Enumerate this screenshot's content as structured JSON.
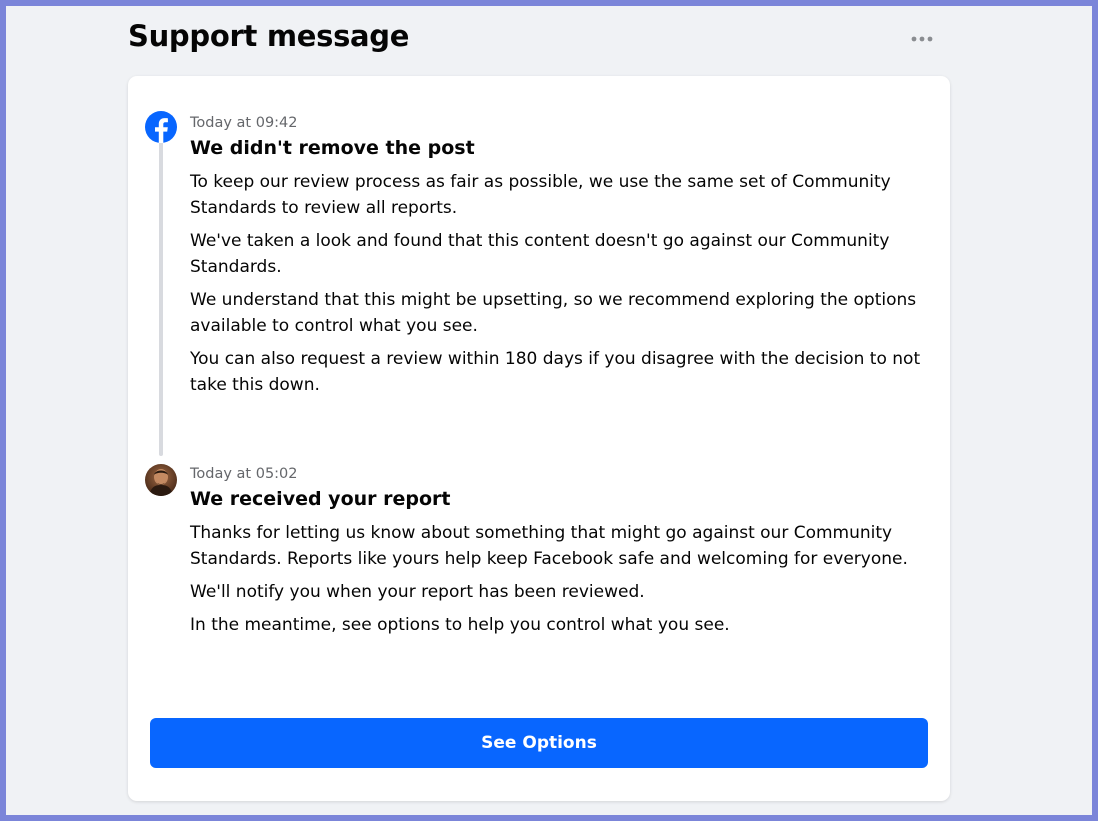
{
  "page": {
    "title": "Support message"
  },
  "header": {
    "more_icon": "more-horizontal-icon"
  },
  "messages": [
    {
      "sender_icon": "facebook-logo",
      "time": "Today at 09:42",
      "title": "We didn't remove the post",
      "paragraphs": [
        "To keep our review process as fair as possible, we use the same set of Community Standards to review all reports.",
        "We've taken a look and found that this content doesn't go against our Community Standards.",
        "We understand that this might be upsetting, so we recommend exploring the options available to control what you see.",
        "You can also request a review within 180 days if you disagree with the decision to not take this down."
      ]
    },
    {
      "sender_icon": "user-avatar",
      "time": "Today at 05:02",
      "title": "We received your report",
      "paragraphs": [
        "Thanks for letting us know about something that might go against our Community Standards. Reports like yours help keep Facebook safe and welcoming for everyone.",
        "We'll notify you when your report has been reviewed.",
        "In the meantime, see options to help you control what you see."
      ]
    }
  ],
  "actions": {
    "see_options_label": "See Options"
  },
  "colors": {
    "brand_blue": "#0866ff",
    "page_background": "#f0f2f5",
    "border_frame": "#7b85d9",
    "secondary_text": "#65676b",
    "timeline": "#d8dadf"
  }
}
